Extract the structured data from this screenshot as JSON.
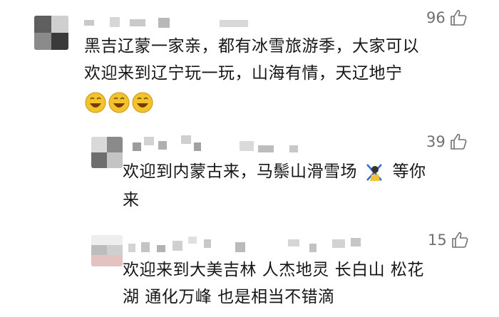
{
  "comments": [
    {
      "likes": "96",
      "text_lines": [
        "黑吉辽蒙一家亲，都有冰雪旅游季，大家可以",
        "欢迎来到辽宁玩一玩，山海有情，天辽地宁"
      ],
      "emoji": "laughing-face-emoji"
    },
    {
      "likes": "39",
      "text_lines": [
        "欢迎到内蒙古来，马鬃山滑雪场",
        "等你",
        "来"
      ],
      "emoji": "skiing-emoji"
    },
    {
      "likes": "15",
      "text_lines": [
        "欢迎来到大美吉林 人杰地灵 长白山 松花",
        "湖 通化万峰 也是相当不错滴"
      ]
    }
  ],
  "icons": {
    "like": "thumbs-up-icon"
  },
  "colors": {
    "text": "#161616",
    "meta": "#707070",
    "redacted": "#c9c9c9"
  }
}
